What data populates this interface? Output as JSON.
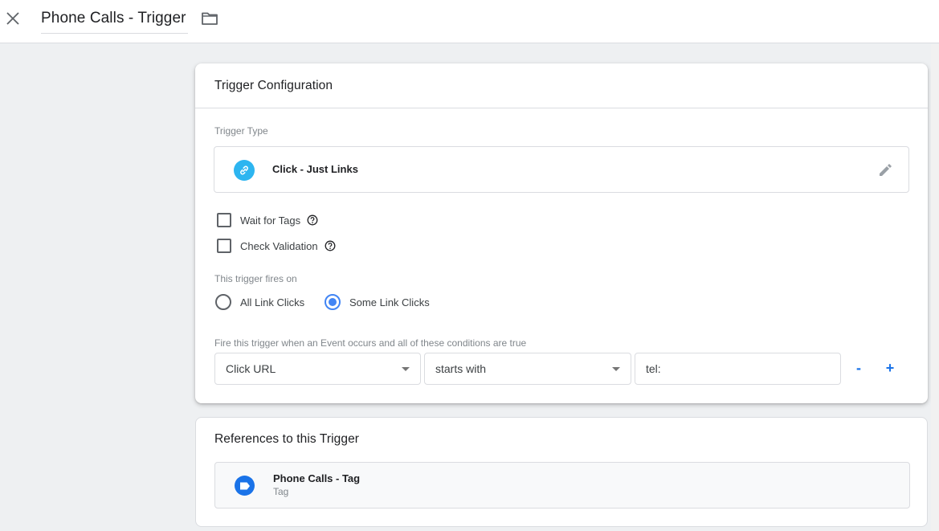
{
  "header": {
    "title": "Phone Calls - Trigger",
    "close_icon": "close-icon",
    "folder_icon": "folder-icon"
  },
  "trigger_config": {
    "title": "Trigger Configuration",
    "trigger_type_label": "Trigger Type",
    "trigger_type": {
      "name": "Click - Just Links",
      "icon": "link-icon",
      "icon_color": "#2db5f0",
      "edit_icon": "pencil-icon"
    },
    "options": [
      {
        "label": "Wait for Tags",
        "checked": false,
        "help_icon": "help-icon"
      },
      {
        "label": "Check Validation",
        "checked": false,
        "help_icon": "help-icon"
      }
    ],
    "fires_on_label": "This trigger fires on",
    "fires_on": [
      {
        "label": "All Link Clicks",
        "selected": false
      },
      {
        "label": "Some Link Clicks",
        "selected": true
      }
    ],
    "conditions_label": "Fire this trigger when an Event occurs and all of these conditions are true",
    "condition": {
      "variable": "Click URL",
      "operator": "starts with",
      "value": "tel:",
      "remove_label": "-",
      "add_label": "+"
    }
  },
  "references": {
    "title": "References to this Trigger",
    "items": [
      {
        "name": "Phone Calls - Tag",
        "type": "Tag",
        "icon": "tag-icon",
        "icon_color": "#1a73e8"
      }
    ]
  },
  "colors": {
    "accent": "#1a73e8",
    "radio_selected": "#4285f4",
    "background": "#eef0f2"
  }
}
